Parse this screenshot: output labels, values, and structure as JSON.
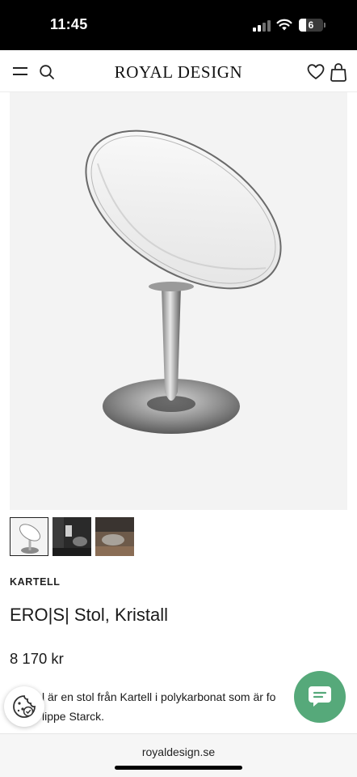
{
  "status_bar": {
    "time": "11:45",
    "battery_level": "6",
    "signal_icon": "signal-bars-icon",
    "wifi_icon": "wifi-icon"
  },
  "header": {
    "logo": "ROYAL DESIGN",
    "menu_icon": "hamburger-menu-icon",
    "search_icon": "search-icon",
    "wishlist_icon": "heart-icon",
    "cart_icon": "shopping-bag-icon"
  },
  "product": {
    "brand": "KARTELL",
    "title": "ERO|S| Stol, Kristall",
    "price": "8 170 kr",
    "description_line1": "l är en stol från Kartell i polykarbonat som är fo",
    "description_line2": "lippe Starck.",
    "thumbnail_count": 3,
    "active_thumbnail": 1
  },
  "floating": {
    "cookie_icon": "cookie-icon",
    "chat_icon": "chat-bubble-icon",
    "chat_color": "#56a97a"
  },
  "browser": {
    "url": "royaldesign.se"
  }
}
